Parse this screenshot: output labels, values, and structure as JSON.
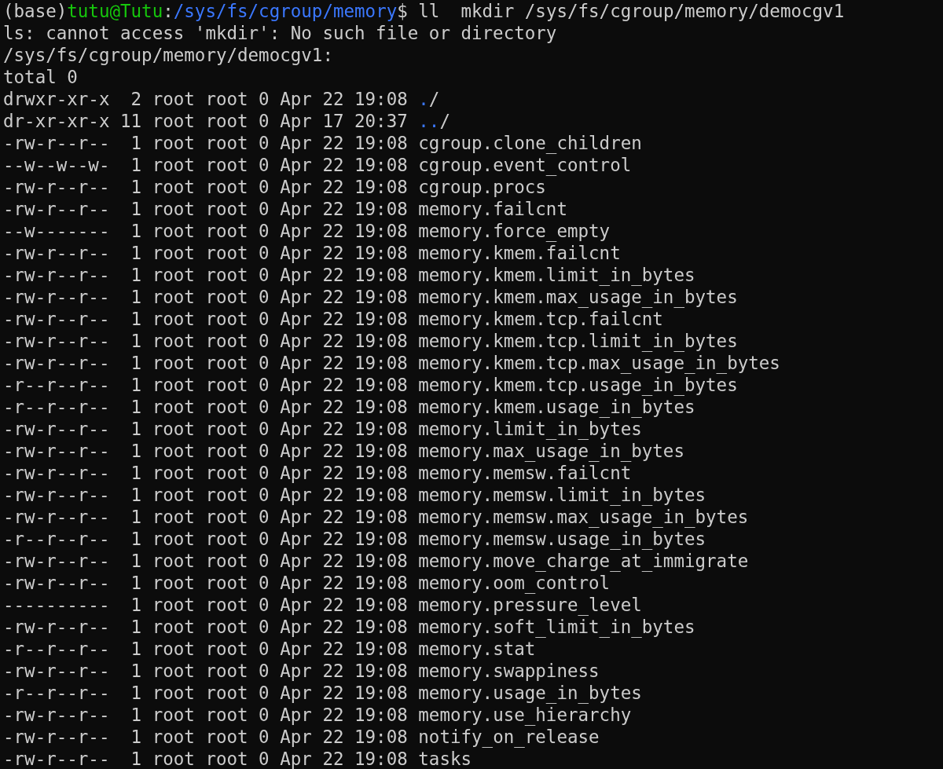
{
  "prompt": {
    "env": "(base)",
    "user_host": "tutu@Tutu",
    "separator": ":",
    "path": "/sys/fs/cgroup/memory",
    "symbol": "$",
    "command": "ll  mkdir /sys/fs/cgroup/memory/democgv1"
  },
  "output_lines": [
    "ls: cannot access 'mkdir': No such file or directory",
    "/sys/fs/cgroup/memory/democgv1:",
    "total 0"
  ],
  "listing": [
    {
      "info": "drwxr-xr-x  2 root root 0 Apr 22 19:08",
      "name": ".",
      "suffix": "/",
      "kind": "dir"
    },
    {
      "info": "dr-xr-xr-x 11 root root 0 Apr 17 20:37",
      "name": "..",
      "suffix": "/",
      "kind": "dir"
    },
    {
      "info": "-rw-r--r--  1 root root 0 Apr 22 19:08",
      "name": "cgroup.clone_children",
      "kind": "file"
    },
    {
      "info": "--w--w--w-  1 root root 0 Apr 22 19:08",
      "name": "cgroup.event_control",
      "kind": "file"
    },
    {
      "info": "-rw-r--r--  1 root root 0 Apr 22 19:08",
      "name": "cgroup.procs",
      "kind": "file"
    },
    {
      "info": "-rw-r--r--  1 root root 0 Apr 22 19:08",
      "name": "memory.failcnt",
      "kind": "file"
    },
    {
      "info": "--w-------  1 root root 0 Apr 22 19:08",
      "name": "memory.force_empty",
      "kind": "file"
    },
    {
      "info": "-rw-r--r--  1 root root 0 Apr 22 19:08",
      "name": "memory.kmem.failcnt",
      "kind": "file"
    },
    {
      "info": "-rw-r--r--  1 root root 0 Apr 22 19:08",
      "name": "memory.kmem.limit_in_bytes",
      "kind": "file"
    },
    {
      "info": "-rw-r--r--  1 root root 0 Apr 22 19:08",
      "name": "memory.kmem.max_usage_in_bytes",
      "kind": "file"
    },
    {
      "info": "-rw-r--r--  1 root root 0 Apr 22 19:08",
      "name": "memory.kmem.tcp.failcnt",
      "kind": "file"
    },
    {
      "info": "-rw-r--r--  1 root root 0 Apr 22 19:08",
      "name": "memory.kmem.tcp.limit_in_bytes",
      "kind": "file"
    },
    {
      "info": "-rw-r--r--  1 root root 0 Apr 22 19:08",
      "name": "memory.kmem.tcp.max_usage_in_bytes",
      "kind": "file"
    },
    {
      "info": "-r--r--r--  1 root root 0 Apr 22 19:08",
      "name": "memory.kmem.tcp.usage_in_bytes",
      "kind": "file"
    },
    {
      "info": "-r--r--r--  1 root root 0 Apr 22 19:08",
      "name": "memory.kmem.usage_in_bytes",
      "kind": "file"
    },
    {
      "info": "-rw-r--r--  1 root root 0 Apr 22 19:08",
      "name": "memory.limit_in_bytes",
      "kind": "file"
    },
    {
      "info": "-rw-r--r--  1 root root 0 Apr 22 19:08",
      "name": "memory.max_usage_in_bytes",
      "kind": "file"
    },
    {
      "info": "-rw-r--r--  1 root root 0 Apr 22 19:08",
      "name": "memory.memsw.failcnt",
      "kind": "file"
    },
    {
      "info": "-rw-r--r--  1 root root 0 Apr 22 19:08",
      "name": "memory.memsw.limit_in_bytes",
      "kind": "file"
    },
    {
      "info": "-rw-r--r--  1 root root 0 Apr 22 19:08",
      "name": "memory.memsw.max_usage_in_bytes",
      "kind": "file"
    },
    {
      "info": "-r--r--r--  1 root root 0 Apr 22 19:08",
      "name": "memory.memsw.usage_in_bytes",
      "kind": "file"
    },
    {
      "info": "-rw-r--r--  1 root root 0 Apr 22 19:08",
      "name": "memory.move_charge_at_immigrate",
      "kind": "file"
    },
    {
      "info": "-rw-r--r--  1 root root 0 Apr 22 19:08",
      "name": "memory.oom_control",
      "kind": "file"
    },
    {
      "info": "----------  1 root root 0 Apr 22 19:08",
      "name": "memory.pressure_level",
      "kind": "file"
    },
    {
      "info": "-rw-r--r--  1 root root 0 Apr 22 19:08",
      "name": "memory.soft_limit_in_bytes",
      "kind": "file"
    },
    {
      "info": "-r--r--r--  1 root root 0 Apr 22 19:08",
      "name": "memory.stat",
      "kind": "file"
    },
    {
      "info": "-rw-r--r--  1 root root 0 Apr 22 19:08",
      "name": "memory.swappiness",
      "kind": "file"
    },
    {
      "info": "-r--r--r--  1 root root 0 Apr 22 19:08",
      "name": "memory.usage_in_bytes",
      "kind": "file"
    },
    {
      "info": "-rw-r--r--  1 root root 0 Apr 22 19:08",
      "name": "memory.use_hierarchy",
      "kind": "file"
    },
    {
      "info": "-rw-r--r--  1 root root 0 Apr 22 19:08",
      "name": "notify_on_release",
      "kind": "file"
    },
    {
      "info": "-rw-r--r--  1 root root 0 Apr 22 19:08",
      "name": "tasks",
      "kind": "file"
    }
  ]
}
